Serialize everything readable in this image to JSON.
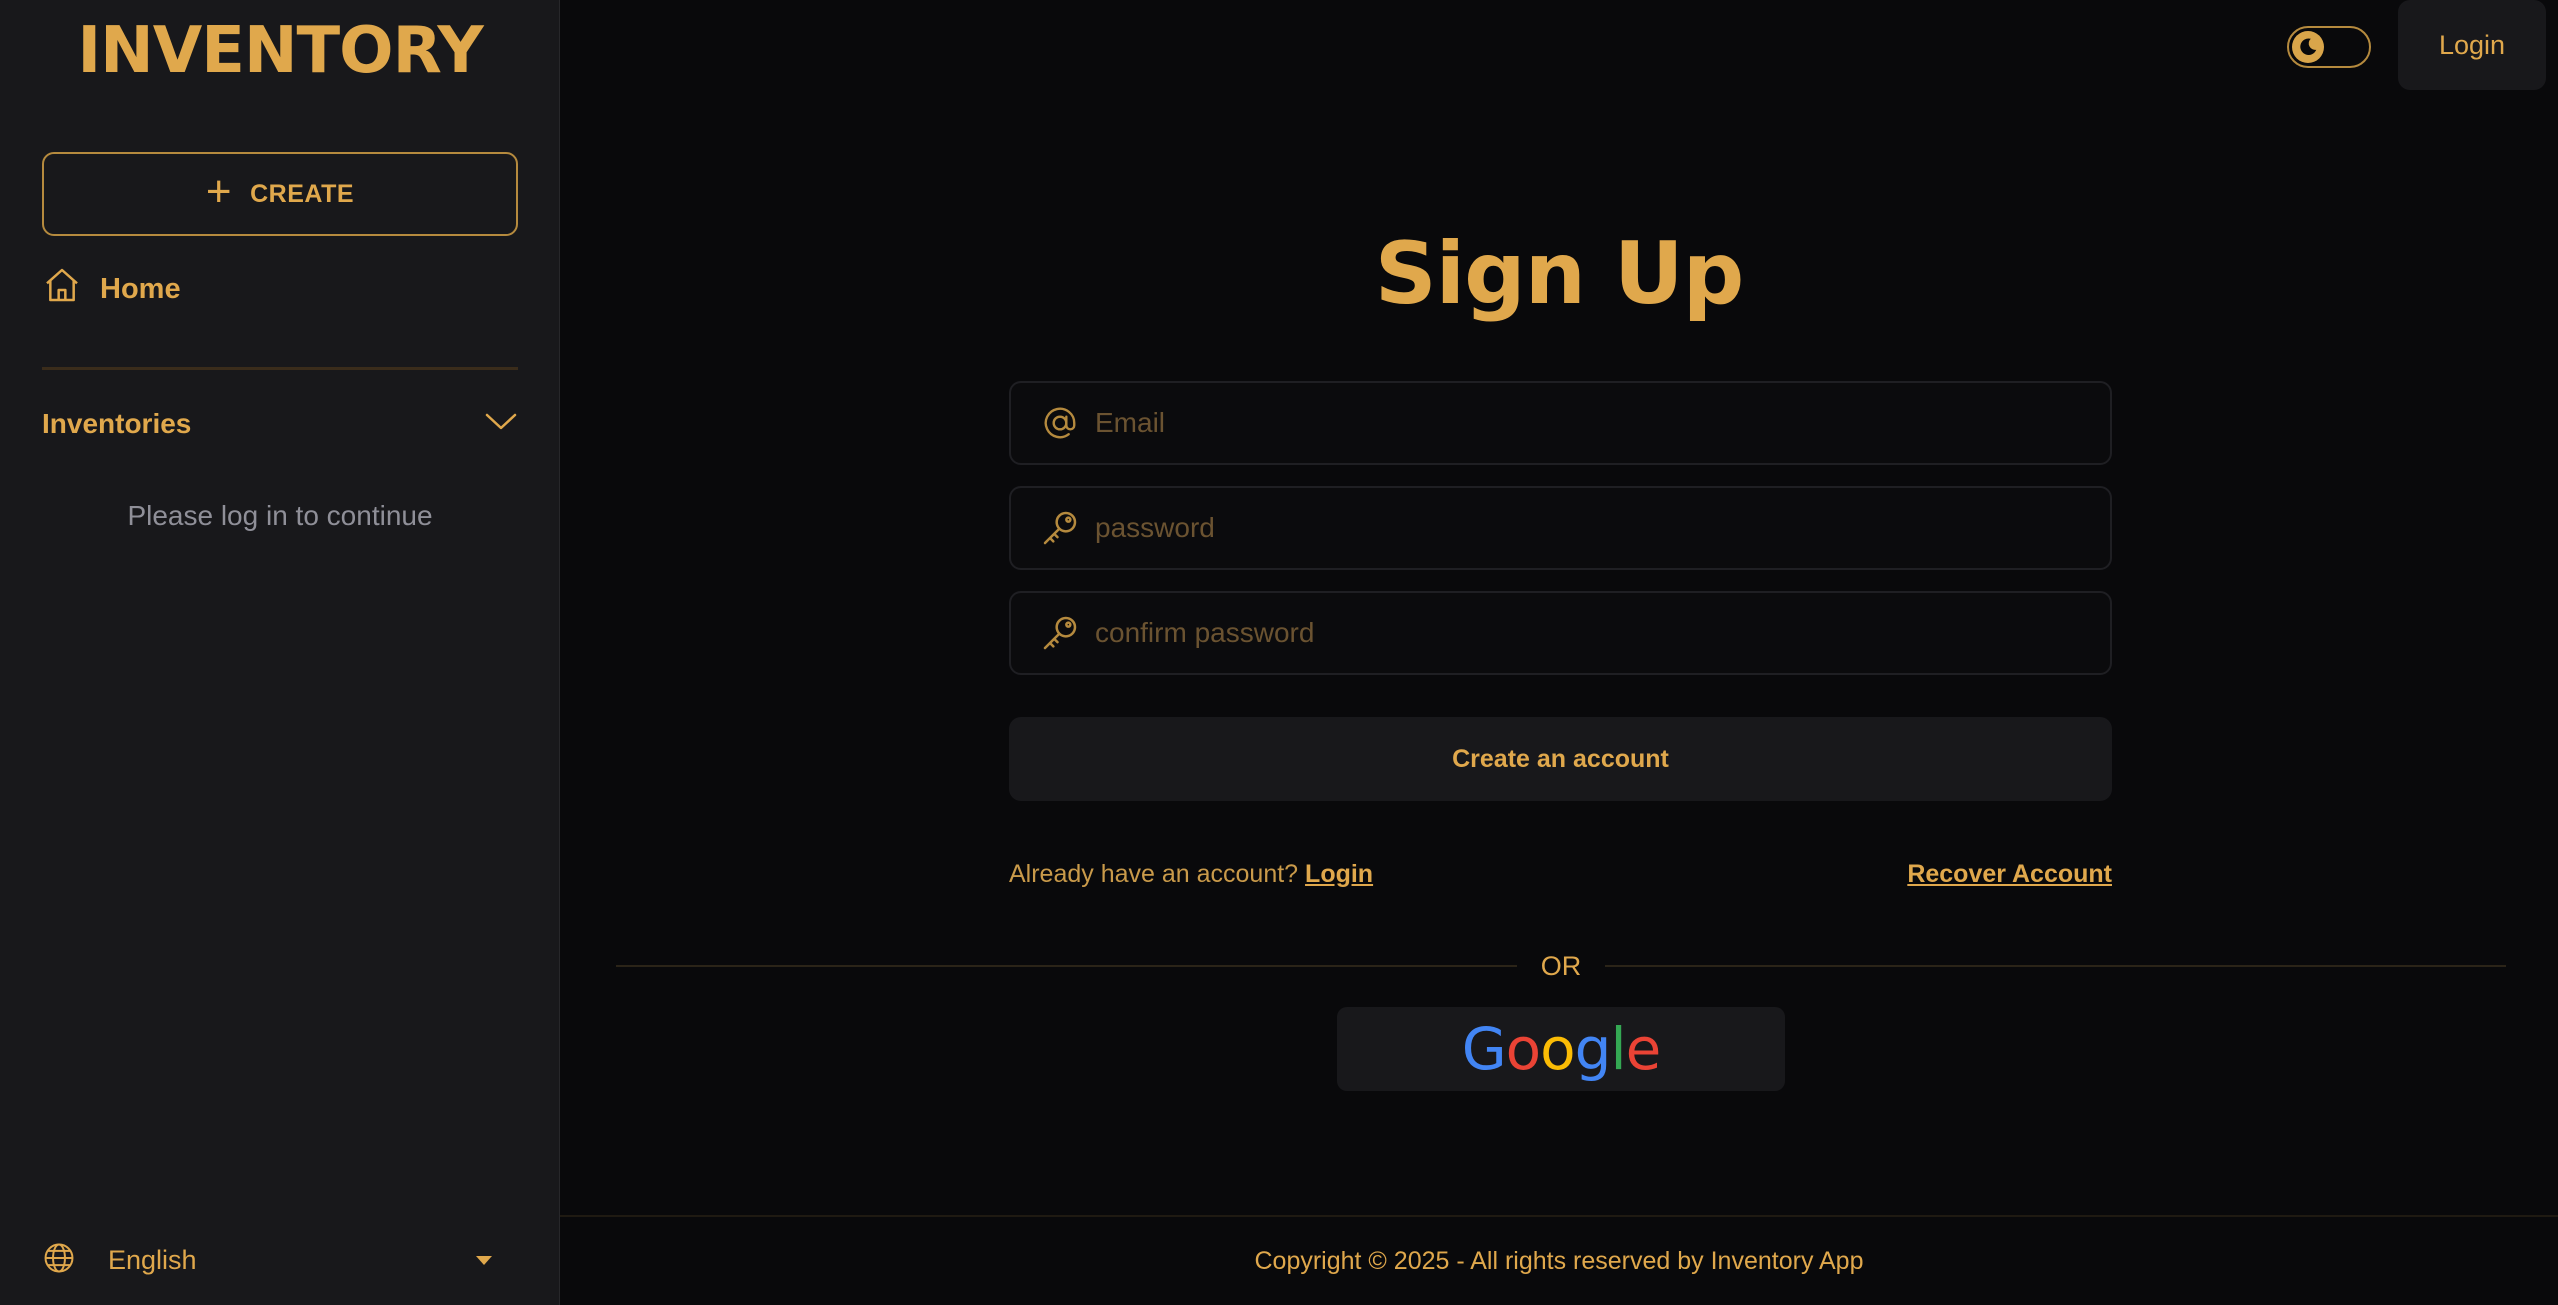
{
  "app": {
    "logo": "INVENTORY"
  },
  "sidebar": {
    "create_label": "CREATE",
    "home_label": "Home",
    "inventories_label": "Inventories",
    "login_hint": "Please log in to continue",
    "language": "English"
  },
  "topbar": {
    "login_label": "Login"
  },
  "form": {
    "title": "Sign Up",
    "email_placeholder": "Email",
    "password_placeholder": "password",
    "confirm_placeholder": "confirm password",
    "submit_label": "Create an account",
    "already_prompt": "Already have an account?",
    "login_link": "Login",
    "recover_link": "Recover Account",
    "or_text": "OR",
    "google": {
      "letters": [
        "G",
        "o",
        "o",
        "g",
        "l",
        "e"
      ],
      "colors": [
        "#4285f4",
        "#ea4335",
        "#fbbc05",
        "#4285f4",
        "#34a853",
        "#ea4335"
      ]
    }
  },
  "footer": {
    "copyright": "Copyright © 2025 - All rights reserved by Inventory App"
  },
  "colors": {
    "accent": "#e0a84c",
    "background": "#09090b",
    "surface": "#18181b"
  }
}
